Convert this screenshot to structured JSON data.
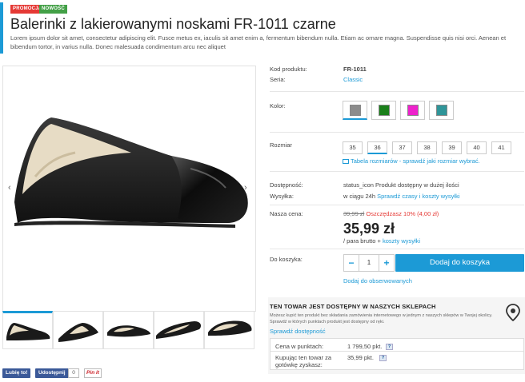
{
  "badges": {
    "promo": "PROMOCJA",
    "new": "NOWOŚĆ"
  },
  "product": {
    "title": "Balerinki z lakierowanymi noskami FR-1011 czarne",
    "description": "Lorem ipsum dolor sit amet, consectetur adipiscing elit. Fusce metus ex, iaculis sit amet enim a, fermentum bibendum nulla. Etiam ac ornare magna. Suspendisse quis nisi orci. Aenean et bibendum tortor, in varius nulla. Donec malesuada condimentum arcu nec aliquet"
  },
  "gallery": {
    "prev_icon": "‹",
    "next_icon": "›"
  },
  "social": {
    "like": "Lubię to!",
    "share": "Udostępnij",
    "count": "0",
    "pin": "Pin it"
  },
  "details": {
    "code_label": "Kod produktu:",
    "code_value": "FR-1011",
    "series_label": "Seria:",
    "series_value": "Classic",
    "color_label": "Kolor:",
    "colors": [
      "#8c8c8c",
      "#1a7f1a",
      "#ee22cc",
      "#2f9599"
    ],
    "size_label": "Rozmiar",
    "sizes": [
      "35",
      "36",
      "37",
      "38",
      "39",
      "40",
      "41"
    ],
    "selected_size": "36",
    "size_table_link": "Tabela rozmiarów - sprawdź jaki rozmiar wybrać.",
    "availability_label": "Dostępność:",
    "availability_icon_alt": "status_icon",
    "availability_value": "Produkt dostępny w dużej ilości",
    "shipping_label": "Wysyłka:",
    "shipping_value": "w ciągu 24h",
    "shipping_link": "Sprawdź czasy i koszty wysyłki",
    "price_label": "Nasza cena:",
    "old_price": "39,99 zł",
    "savings": "Oszczędzasz 10% (4,00 zł)",
    "price": "35,99 zł",
    "price_note": "/ para brutto +",
    "shipping_costs_link": "koszty wysyłki",
    "cart_label": "Do koszyka:",
    "qty_minus": "−",
    "qty_value": "1",
    "qty_plus": "+",
    "add_to_cart": "Dodaj do koszyka",
    "watchlist": "Dodaj do obserwowanych"
  },
  "store": {
    "title": "TEN TOWAR JEST DOSTĘPNY W NASZYCH SKLEPACH",
    "desc": "Możesz kupić ten produkt bez składania zamówienia internetowego w jednym z naszych sklepów w Twojej okolicy. Sprawdź w których punktach produkt jest dostępny od ręki.",
    "link": "Sprawdź dostępność",
    "points_label": "Cena w punktach:",
    "points_value": "1 799,50 pkt.",
    "earn_label": "Kupując ten towar za gotówkę zyskasz:",
    "earn_value": "35,99 pkt.",
    "help": "?"
  },
  "icons": {
    "status": "status-icon",
    "map_pin": "map-pin-icon",
    "table": "ruler-table-icon"
  }
}
